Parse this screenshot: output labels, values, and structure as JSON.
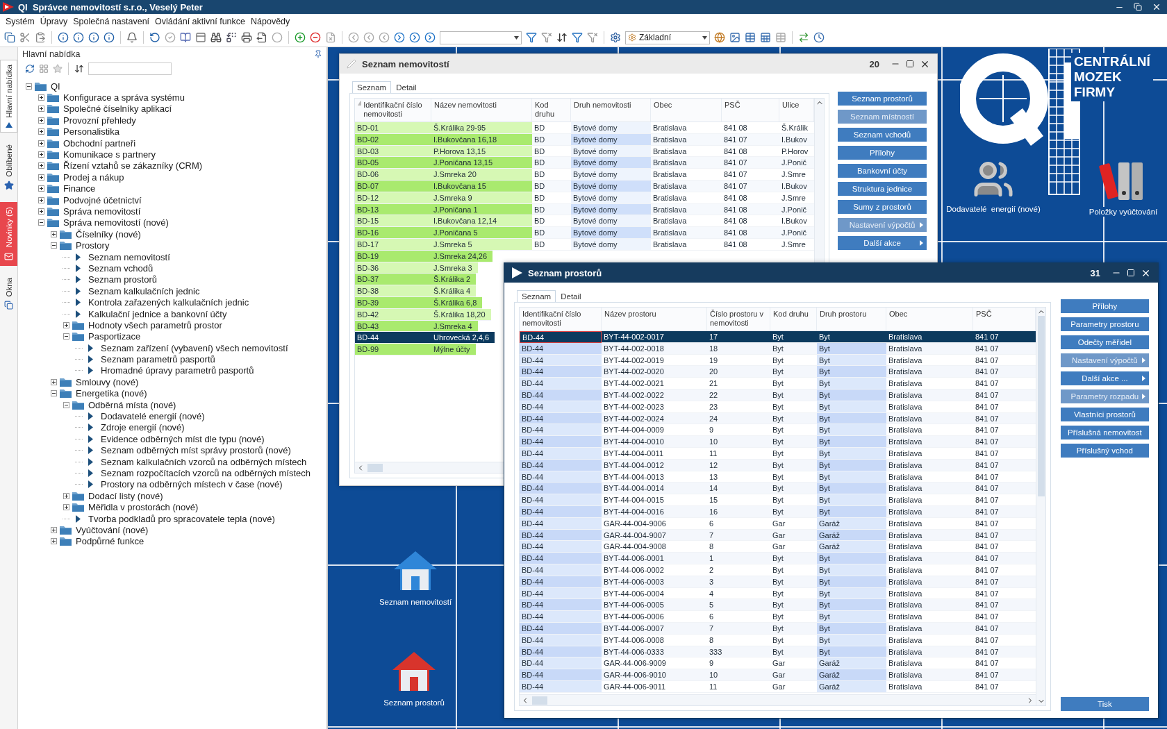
{
  "app_title": "QI  Správce nemovitostí s.r.o., Veselý Peter",
  "menu": [
    "Systém",
    "Úpravy",
    "Společná nastavení",
    "Ovládání aktivní funkce",
    "Nápovědy"
  ],
  "toolbar": {
    "view_combo": "Základní"
  },
  "side_tabs": [
    {
      "label": "Hlavní nabídka",
      "selected": true,
      "kind": "menu"
    },
    {
      "label": "Oblíbené",
      "selected": false,
      "kind": "favorites"
    },
    {
      "label": "Novinky (5)",
      "selected": false,
      "kind": "news"
    },
    {
      "label": "Okna",
      "selected": false,
      "kind": "windows"
    }
  ],
  "navigator": {
    "title": "Hlavní nabídka",
    "tree": [
      {
        "label": "QI",
        "kind": "folder",
        "expanded": true,
        "children": [
          {
            "label": "Konfigurace a správa systému",
            "kind": "folder",
            "expanded": false
          },
          {
            "label": "Společné číselníky aplikací",
            "kind": "folder",
            "expanded": false
          },
          {
            "label": "Provozní přehledy",
            "kind": "folder",
            "expanded": false
          },
          {
            "label": "Personalistika",
            "kind": "folder",
            "expanded": false
          },
          {
            "label": "Obchodní partneři",
            "kind": "folder",
            "expanded": false
          },
          {
            "label": "Komunikace s partnery",
            "kind": "folder",
            "expanded": false
          },
          {
            "label": "Řízení vztahů se zákazníky (CRM)",
            "kind": "folder",
            "expanded": false
          },
          {
            "label": "Prodej a nákup",
            "kind": "folder",
            "expanded": false
          },
          {
            "label": "Finance",
            "kind": "folder",
            "expanded": false
          },
          {
            "label": "Podvojné účetnictví",
            "kind": "folder",
            "expanded": false
          },
          {
            "label": "Správa nemovitostí",
            "kind": "folder",
            "expanded": false
          },
          {
            "label": "Správa nemovitostí (nové)",
            "kind": "folder",
            "expanded": true,
            "children": [
              {
                "label": "Číselníky (nové)",
                "kind": "folder",
                "expanded": false
              },
              {
                "label": "Prostory",
                "kind": "folder",
                "expanded": true,
                "children": [
                  {
                    "label": "Seznam nemovitostí",
                    "kind": "item"
                  },
                  {
                    "label": "Seznam vchodů",
                    "kind": "item"
                  },
                  {
                    "label": "Seznam prostorů",
                    "kind": "item"
                  },
                  {
                    "label": "Seznam kalkulačních jednic",
                    "kind": "item"
                  },
                  {
                    "label": "Kontrola zařazených kalkulačních jednic",
                    "kind": "item"
                  },
                  {
                    "label": "Kalkulační jednice a bankovní účty",
                    "kind": "item"
                  },
                  {
                    "label": "Hodnoty všech parametrů prostor",
                    "kind": "folder",
                    "expanded": false
                  },
                  {
                    "label": "Pasportizace",
                    "kind": "folder",
                    "expanded": true,
                    "children": [
                      {
                        "label": "Seznam zařízení (vybavení) všech nemovitostí",
                        "kind": "item"
                      },
                      {
                        "label": "Seznam parametrů pasportů",
                        "kind": "item"
                      },
                      {
                        "label": "Hromadné úpravy parametrů pasportů",
                        "kind": "item"
                      }
                    ]
                  }
                ]
              },
              {
                "label": "Smlouvy (nové)",
                "kind": "folder",
                "expanded": false
              },
              {
                "label": "Energetika (nové)",
                "kind": "folder",
                "expanded": true,
                "children": [
                  {
                    "label": "Odběrná místa (nové)",
                    "kind": "folder",
                    "expanded": true,
                    "children": [
                      {
                        "label": "Dodavatelé  energií (nové)",
                        "kind": "item"
                      },
                      {
                        "label": "Zdroje energií (nové)",
                        "kind": "item"
                      },
                      {
                        "label": "Evidence odběrných míst dle typu (nové)",
                        "kind": "item"
                      },
                      {
                        "label": "Seznam odběrných míst správy prostorů (nové)",
                        "kind": "item"
                      },
                      {
                        "label": "Seznam kalkulačních vzorců na odběrných místech",
                        "kind": "item"
                      },
                      {
                        "label": "Seznam rozpočítacích vzorců na odběrných místech",
                        "kind": "item"
                      },
                      {
                        "label": "Prostory na odběrných místech v čase (nové)",
                        "kind": "item"
                      }
                    ]
                  },
                  {
                    "label": "Dodací listy (nové)",
                    "kind": "folder",
                    "expanded": false
                  },
                  {
                    "label": "Měřidla v prostorách (nové)",
                    "kind": "folder",
                    "expanded": false
                  },
                  {
                    "label": "Tvorba podkladů pro spracovatele tepla (nové)",
                    "kind": "item"
                  }
                ]
              },
              {
                "label": "Vyúčtování (nové)",
                "kind": "folder",
                "expanded": false
              },
              {
                "label": "Podpůrné funkce",
                "kind": "folder",
                "expanded": false
              }
            ]
          }
        ]
      }
    ]
  },
  "desktop": {
    "logo_lines": [
      "CENTRÁLNÍ",
      "MOZEK",
      "FIRMY"
    ],
    "tiles": [
      {
        "label": "Dodavatelé  energií (nové)",
        "kind": "people"
      },
      {
        "label": "Položky vyúčtování",
        "kind": "binders"
      },
      {
        "label": "Seznam nemovitostí",
        "kind": "home",
        "color": "#2f86d8"
      },
      {
        "label": "Seznam prostorů",
        "kind": "home",
        "color": "#d8342c"
      }
    ]
  },
  "windows": [
    {
      "title": "Seznam nemovitostí",
      "count": "20",
      "active": false,
      "tabs": [
        {
          "label": "Seznam",
          "selected": true
        },
        {
          "label": "Detail",
          "selected": false
        }
      ],
      "columns": [
        {
          "label": "Identifikační číslo nemovitosti",
          "sorted": true
        },
        {
          "label": "Název nemovitosti",
          "sorted": false
        },
        {
          "label": "Kod druhu",
          "sorted": false
        },
        {
          "label": "Druh nemovitosti",
          "sorted": false
        },
        {
          "label": "Obec",
          "sorted": false
        },
        {
          "label": "PSČ",
          "sorted": false
        },
        {
          "label": "Ulice",
          "sorted": false
        }
      ],
      "rows": [
        {
          "selected": false,
          "cells": [
            "BD-01",
            "Š.Králika 29-95",
            "BD",
            "Bytové domy",
            "Bratislava",
            "841 08",
            "Š.Králik"
          ]
        },
        {
          "selected": false,
          "cells": [
            "BD-02",
            "I.Bukovčana 16,18",
            "BD",
            "Bytové domy",
            "Bratislava",
            "841 07",
            "I.Bukov"
          ]
        },
        {
          "selected": false,
          "cells": [
            "BD-03",
            "P.Horova 13,15",
            "BD",
            "Bytové domy",
            "Bratislava",
            "841 08",
            "P.Horov"
          ]
        },
        {
          "selected": false,
          "cells": [
            "BD-05",
            "J.Poničana 13,15",
            "BD",
            "Bytové domy",
            "Bratislava",
            "841 07",
            "J.Ponič"
          ]
        },
        {
          "selected": false,
          "cells": [
            "BD-06",
            "J.Smreka 20",
            "BD",
            "Bytové domy",
            "Bratislava",
            "841 07",
            "J.Smre"
          ]
        },
        {
          "selected": false,
          "cells": [
            "BD-07",
            "I.Bukovčana 15",
            "BD",
            "Bytové domy",
            "Bratislava",
            "841 07",
            "I.Bukov"
          ]
        },
        {
          "selected": false,
          "cells": [
            "BD-12",
            "J.Smreka 9",
            "BD",
            "Bytové domy",
            "Bratislava",
            "841 08",
            "J.Smre"
          ]
        },
        {
          "selected": false,
          "cells": [
            "BD-13",
            "J.Poničana 1",
            "BD",
            "Bytové domy",
            "Bratislava",
            "841 08",
            "J.Ponič"
          ]
        },
        {
          "selected": false,
          "cells": [
            "BD-15",
            "I.Bukovčana 12,14",
            "BD",
            "Bytové domy",
            "Bratislava",
            "841 08",
            "I.Bukov"
          ]
        },
        {
          "selected": false,
          "cells": [
            "BD-16",
            "J.Poničana 5",
            "BD",
            "Bytové domy",
            "Bratislava",
            "841 08",
            "J.Ponič"
          ]
        },
        {
          "selected": false,
          "cells": [
            "BD-17",
            "J.Smreka 5",
            "BD",
            "Bytové domy",
            "Bratislava",
            "841 08",
            "J.Smre"
          ]
        },
        {
          "selected": false,
          "cells": [
            "BD-19",
            "J.Smreka 24,26"
          ]
        },
        {
          "selected": false,
          "cells": [
            "BD-36",
            "J.Smreka 3"
          ]
        },
        {
          "selected": false,
          "cells": [
            "BD-37",
            "Š.Králika 2"
          ]
        },
        {
          "selected": false,
          "cells": [
            "BD-38",
            "Š.Králika 4"
          ]
        },
        {
          "selected": false,
          "cells": [
            "BD-39",
            "Š.Králika 6,8"
          ]
        },
        {
          "selected": false,
          "cells": [
            "BD-42",
            "Š.Králika 18,20"
          ]
        },
        {
          "selected": false,
          "cells": [
            "BD-43",
            "J.Smreka 4"
          ]
        },
        {
          "selected": true,
          "cells": [
            "BD-44",
            "Uhrovecká 2,4,6"
          ]
        },
        {
          "selected": false,
          "cells": [
            "BD-99",
            "Mýlne účty"
          ]
        }
      ],
      "buttons": [
        {
          "label": "Seznam prostorů",
          "disabled": false,
          "submenu": false
        },
        {
          "label": "Seznam místností",
          "disabled": true,
          "submenu": false
        },
        {
          "label": "Seznam vchodů",
          "disabled": false,
          "submenu": false
        },
        {
          "label": "Přílohy",
          "disabled": false,
          "submenu": false
        },
        {
          "label": "Bankovní účty",
          "disabled": false,
          "submenu": false
        },
        {
          "label": "Struktura jednice",
          "disabled": false,
          "submenu": false
        },
        {
          "label": "Sumy z prostorů",
          "disabled": false,
          "submenu": false
        },
        {
          "label": "Nastavení výpočtů",
          "disabled": true,
          "submenu": true
        },
        {
          "label": "Další akce",
          "disabled": false,
          "submenu": true
        }
      ]
    },
    {
      "title": "Seznam prostorů",
      "count": "31",
      "active": true,
      "tabs": [
        {
          "label": "Seznam",
          "selected": true
        },
        {
          "label": "Detail",
          "selected": false
        }
      ],
      "columns": [
        {
          "label": "Identifikační číslo nemovitosti",
          "sorted": false
        },
        {
          "label": "Název prostoru",
          "sorted": false
        },
        {
          "label": "Číslo prostoru v nemovitosti",
          "sorted": false
        },
        {
          "label": "Kod druhu",
          "sorted": false
        },
        {
          "label": "Druh prostoru",
          "sorted": false
        },
        {
          "label": "Obec",
          "sorted": false
        },
        {
          "label": "PSČ",
          "sorted": false
        }
      ],
      "rows": [
        {
          "selected": true,
          "cells": [
            "BD-44",
            "BYT-44-002-0017",
            "17",
            "Byt",
            "Byt",
            "Bratislava",
            "841 07"
          ]
        },
        {
          "selected": false,
          "cells": [
            "BD-44",
            "BYT-44-002-0018",
            "18",
            "Byt",
            "Byt",
            "Bratislava",
            "841 07"
          ]
        },
        {
          "selected": false,
          "cells": [
            "BD-44",
            "BYT-44-002-0019",
            "19",
            "Byt",
            "Byt",
            "Bratislava",
            "841 07"
          ]
        },
        {
          "selected": false,
          "cells": [
            "BD-44",
            "BYT-44-002-0020",
            "20",
            "Byt",
            "Byt",
            "Bratislava",
            "841 07"
          ]
        },
        {
          "selected": false,
          "cells": [
            "BD-44",
            "BYT-44-002-0021",
            "21",
            "Byt",
            "Byt",
            "Bratislava",
            "841 07"
          ]
        },
        {
          "selected": false,
          "cells": [
            "BD-44",
            "BYT-44-002-0022",
            "22",
            "Byt",
            "Byt",
            "Bratislava",
            "841 07"
          ]
        },
        {
          "selected": false,
          "cells": [
            "BD-44",
            "BYT-44-002-0023",
            "23",
            "Byt",
            "Byt",
            "Bratislava",
            "841 07"
          ]
        },
        {
          "selected": false,
          "cells": [
            "BD-44",
            "BYT-44-002-0024",
            "24",
            "Byt",
            "Byt",
            "Bratislava",
            "841 07"
          ]
        },
        {
          "selected": false,
          "cells": [
            "BD-44",
            "BYT-44-004-0009",
            "9",
            "Byt",
            "Byt",
            "Bratislava",
            "841 07"
          ]
        },
        {
          "selected": false,
          "cells": [
            "BD-44",
            "BYT-44-004-0010",
            "10",
            "Byt",
            "Byt",
            "Bratislava",
            "841 07"
          ]
        },
        {
          "selected": false,
          "cells": [
            "BD-44",
            "BYT-44-004-0011",
            "11",
            "Byt",
            "Byt",
            "Bratislava",
            "841 07"
          ]
        },
        {
          "selected": false,
          "cells": [
            "BD-44",
            "BYT-44-004-0012",
            "12",
            "Byt",
            "Byt",
            "Bratislava",
            "841 07"
          ]
        },
        {
          "selected": false,
          "cells": [
            "BD-44",
            "BYT-44-004-0013",
            "13",
            "Byt",
            "Byt",
            "Bratislava",
            "841 07"
          ]
        },
        {
          "selected": false,
          "cells": [
            "BD-44",
            "BYT-44-004-0014",
            "14",
            "Byt",
            "Byt",
            "Bratislava",
            "841 07"
          ]
        },
        {
          "selected": false,
          "cells": [
            "BD-44",
            "BYT-44-004-0015",
            "15",
            "Byt",
            "Byt",
            "Bratislava",
            "841 07"
          ]
        },
        {
          "selected": false,
          "cells": [
            "BD-44",
            "BYT-44-004-0016",
            "16",
            "Byt",
            "Byt",
            "Bratislava",
            "841 07"
          ]
        },
        {
          "selected": false,
          "cells": [
            "BD-44",
            "GAR-44-004-9006",
            "6",
            "Gar",
            "Garáž",
            "Bratislava",
            "841 07"
          ]
        },
        {
          "selected": false,
          "cells": [
            "BD-44",
            "GAR-44-004-9007",
            "7",
            "Gar",
            "Garáž",
            "Bratislava",
            "841 07"
          ]
        },
        {
          "selected": false,
          "cells": [
            "BD-44",
            "GAR-44-004-9008",
            "8",
            "Gar",
            "Garáž",
            "Bratislava",
            "841 07"
          ]
        },
        {
          "selected": false,
          "cells": [
            "BD-44",
            "BYT-44-006-0001",
            "1",
            "Byt",
            "Byt",
            "Bratislava",
            "841 07"
          ]
        },
        {
          "selected": false,
          "cells": [
            "BD-44",
            "BYT-44-006-0002",
            "2",
            "Byt",
            "Byt",
            "Bratislava",
            "841 07"
          ]
        },
        {
          "selected": false,
          "cells": [
            "BD-44",
            "BYT-44-006-0003",
            "3",
            "Byt",
            "Byt",
            "Bratislava",
            "841 07"
          ]
        },
        {
          "selected": false,
          "cells": [
            "BD-44",
            "BYT-44-006-0004",
            "4",
            "Byt",
            "Byt",
            "Bratislava",
            "841 07"
          ]
        },
        {
          "selected": false,
          "cells": [
            "BD-44",
            "BYT-44-006-0005",
            "5",
            "Byt",
            "Byt",
            "Bratislava",
            "841 07"
          ]
        },
        {
          "selected": false,
          "cells": [
            "BD-44",
            "BYT-44-006-0006",
            "6",
            "Byt",
            "Byt",
            "Bratislava",
            "841 07"
          ]
        },
        {
          "selected": false,
          "cells": [
            "BD-44",
            "BYT-44-006-0007",
            "7",
            "Byt",
            "Byt",
            "Bratislava",
            "841 07"
          ]
        },
        {
          "selected": false,
          "cells": [
            "BD-44",
            "BYT-44-006-0008",
            "8",
            "Byt",
            "Byt",
            "Bratislava",
            "841 07"
          ]
        },
        {
          "selected": false,
          "cells": [
            "BD-44",
            "BYT-44-006-0333",
            "333",
            "Byt",
            "Byt",
            "Bratislava",
            "841 07"
          ]
        },
        {
          "selected": false,
          "cells": [
            "BD-44",
            "GAR-44-006-9009",
            "9",
            "Gar",
            "Garáž",
            "Bratislava",
            "841 07"
          ]
        },
        {
          "selected": false,
          "cells": [
            "BD-44",
            "GAR-44-006-9010",
            "10",
            "Gar",
            "Garáž",
            "Bratislava",
            "841 07"
          ]
        },
        {
          "selected": false,
          "cells": [
            "BD-44",
            "GAR-44-006-9011",
            "11",
            "Gar",
            "Garáž",
            "Bratislava",
            "841 07"
          ]
        }
      ],
      "buttons": [
        {
          "label": "Přílohy",
          "disabled": false,
          "submenu": false
        },
        {
          "label": "Parametry prostoru",
          "disabled": false,
          "submenu": false
        },
        {
          "label": "Odečty měřidel",
          "disabled": false,
          "submenu": false
        },
        {
          "label": "Nastavení výpočtů",
          "disabled": true,
          "submenu": true
        },
        {
          "label": "Další akce ...",
          "disabled": false,
          "submenu": true
        },
        {
          "label": "Parametry rozpadu",
          "disabled": true,
          "submenu": true
        },
        {
          "label": "Vlastníci prostorů",
          "disabled": false,
          "submenu": false
        },
        {
          "label": "Příslušná nemovitost",
          "disabled": false,
          "submenu": false
        },
        {
          "label": "Příslušný vchod",
          "disabled": false,
          "submenu": false
        }
      ],
      "footer_button": "Tisk"
    }
  ]
}
